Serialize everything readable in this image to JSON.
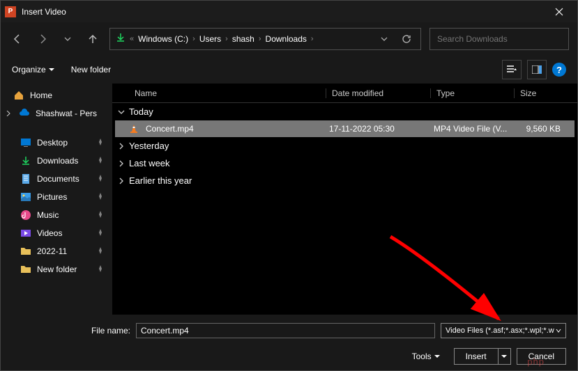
{
  "title": "Insert Video",
  "breadcrumbs": [
    "Windows (C:)",
    "Users",
    "shash",
    "Downloads"
  ],
  "search_placeholder": "Search Downloads",
  "toolbar": {
    "organize": "Organize",
    "newfolder": "New folder"
  },
  "sidebar": {
    "home": "Home",
    "personal": "Shashwat - Pers",
    "desktop": "Desktop",
    "downloads": "Downloads",
    "documents": "Documents",
    "pictures": "Pictures",
    "music": "Music",
    "videos": "Videos",
    "folder1": "2022-11",
    "folder2": "New folder"
  },
  "columns": {
    "name": "Name",
    "date": "Date modified",
    "type": "Type",
    "size": "Size"
  },
  "groups": {
    "today": "Today",
    "yesterday": "Yesterday",
    "lastweek": "Last week",
    "earlier": "Earlier this year"
  },
  "file": {
    "name": "Concert.mp4",
    "date": "17-11-2022 05:30",
    "type": "MP4 Video File (V...",
    "size": "9,560 KB"
  },
  "footer": {
    "filename_label": "File name:",
    "filename_value": "Concert.mp4",
    "filter": "Video Files (*.asf;*.asx;*.wpl;*.w",
    "tools": "Tools",
    "insert": "Insert",
    "cancel": "Cancel"
  },
  "help_glyph": "?",
  "watermark": "php"
}
